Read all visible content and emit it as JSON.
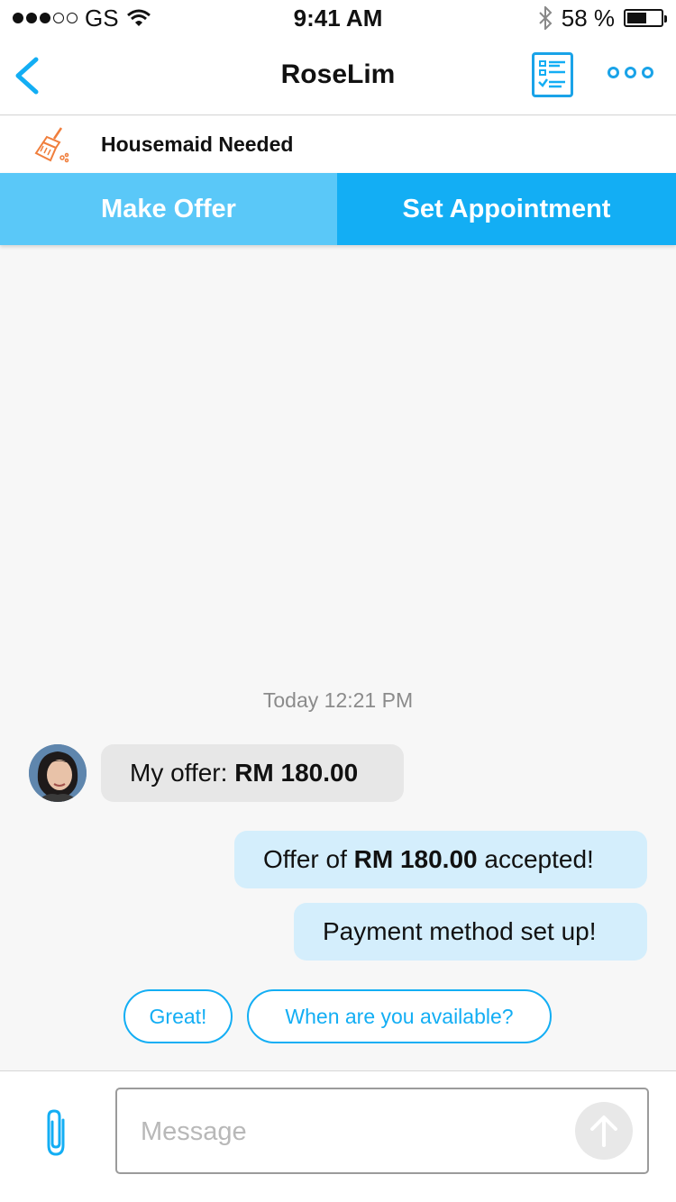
{
  "status_bar": {
    "carrier": "GS",
    "time": "9:41 AM",
    "battery_text": "58 %",
    "battery_level": 0.58
  },
  "nav": {
    "title": "RoseLim"
  },
  "job": {
    "title": "Housemaid Needed",
    "icon": "broom-icon"
  },
  "actions": {
    "make_offer": "Make Offer",
    "set_appointment": "Set Appointment"
  },
  "chat": {
    "timestamp": "Today 12:21 PM",
    "incoming": {
      "prefix": "My offer: ",
      "amount": "RM 180.00"
    },
    "outgoing_1": {
      "prefix": "Offer of ",
      "amount": "RM 180.00",
      "suffix": " accepted!"
    },
    "outgoing_2": {
      "text": "Payment method set up!"
    }
  },
  "quick_replies": [
    "Great!",
    "When are you available?"
  ],
  "composer": {
    "placeholder": "Message"
  },
  "colors": {
    "accent": "#13aef4",
    "accent_light": "#5ac8f8",
    "outgoing_bubble": "#d4eefc",
    "incoming_bubble": "#e7e7e7",
    "broom": "#f07e3c"
  }
}
